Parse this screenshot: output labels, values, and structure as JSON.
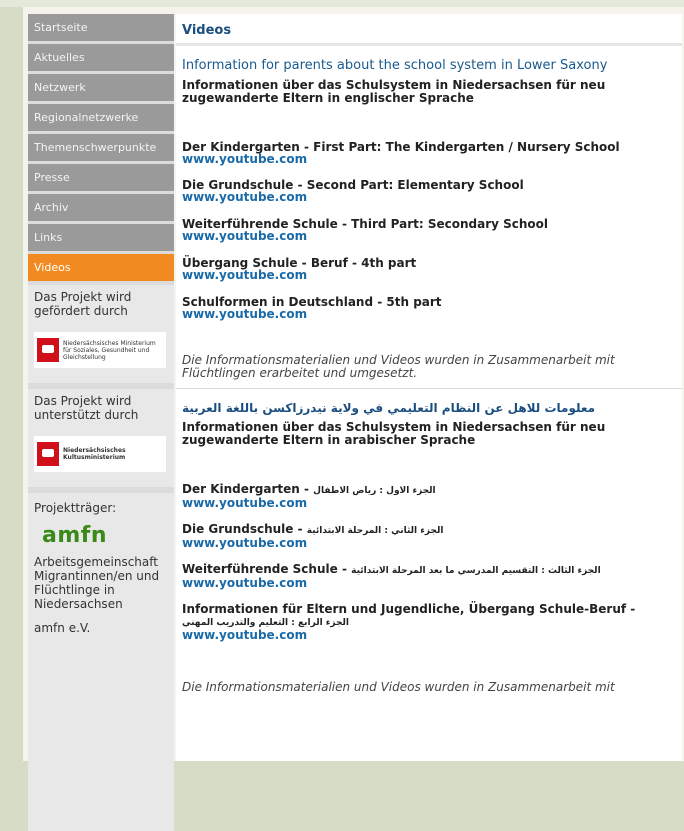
{
  "nav": {
    "items": [
      {
        "label": "Startseite"
      },
      {
        "label": "Aktuelles"
      },
      {
        "label": "Netzwerk"
      },
      {
        "label": "Regionalnetzwerke"
      },
      {
        "label": "Themenschwerpunkte"
      },
      {
        "label": "Presse"
      },
      {
        "label": "Archiv"
      },
      {
        "label": "Links"
      },
      {
        "label": "Videos"
      }
    ],
    "active": "Videos"
  },
  "sidebar": {
    "box1": {
      "text": "Das Projekt wird gefördert durch",
      "logo_text": "Niedersächsisches Ministerium für Soziales, Gesundheit und Gleichstellung"
    },
    "box2": {
      "text": "Das Projekt wird unterstützt durch",
      "logo_text": "Niedersächsisches Kultusministerium"
    },
    "box3": {
      "heading": "Projektträger:",
      "logo_text": "amfn",
      "org_text": "Arbeitsgemeinschaft Migrantinnen/en und Flüchtlinge in Niedersachsen",
      "org_short": "amfn e.V."
    }
  },
  "main": {
    "title": "Videos",
    "english": {
      "title": "Information for parents about the school system in Lower Saxony",
      "intro": "Informationen über das Schulsystem in Niedersachsen für neu zugewanderte Eltern in englischer Sprache",
      "items": [
        {
          "title": "Der Kindergarten - First Part: The Kindergarten / Nursery School",
          "link": "www.youtube.com"
        },
        {
          "title": "Die Grundschule - Second Part: Elementary School",
          "link": "www.youtube.com"
        },
        {
          "title": "Weiterführende Schule - Third Part: Secondary School",
          "link": "www.youtube.com"
        },
        {
          "title": "Übergang Schule - Beruf - 4th part",
          "link": "www.youtube.com"
        },
        {
          "title": "Schulformen in Deutschland - 5th part",
          "link": "www.youtube.com"
        }
      ],
      "note": "Die Informationsmaterialien und Videos wurden in Zusammenarbeit mit Flüchtlingen erarbeitet und umgesetzt."
    },
    "arabic": {
      "title": "معلومات للاهل عن النظام التعليمي في ولاية نيدرزاكسن باللغة العربية",
      "intro": "Informationen über das Schulsystem in Niedersachsen für neu zugewanderte Eltern in arabischer Sprache",
      "items": [
        {
          "title": "Der Kindergarten -",
          "ar": "الجزء الاول : رياض الاطفال",
          "link": "www.youtube.com"
        },
        {
          "title": "Die Grundschule -",
          "ar": "الجزء الثاني : المرحلة الابتدائية",
          "link": "www.youtube.com"
        },
        {
          "title": "Weiterführende Schule -",
          "ar": "الجزء الثالث : التقسيم المدرسي ما بعد المرحلة الابتدائية",
          "link": "www.youtube.com"
        },
        {
          "title": "Informationen für Eltern und Jugendliche, Übergang Schule-Beruf -",
          "ar": "الجزء الرابع : التعليم والتدريب المهني",
          "link": "www.youtube.com"
        }
      ],
      "note": "Die Informationsmaterialien und Videos wurden in Zusammenarbeit mit"
    }
  },
  "colors": {
    "active_nav": "#f28a22",
    "nav": "#9a9a9a",
    "title": "#1a4d80",
    "link": "#1a6aa8",
    "background": "#d6dcc6"
  }
}
